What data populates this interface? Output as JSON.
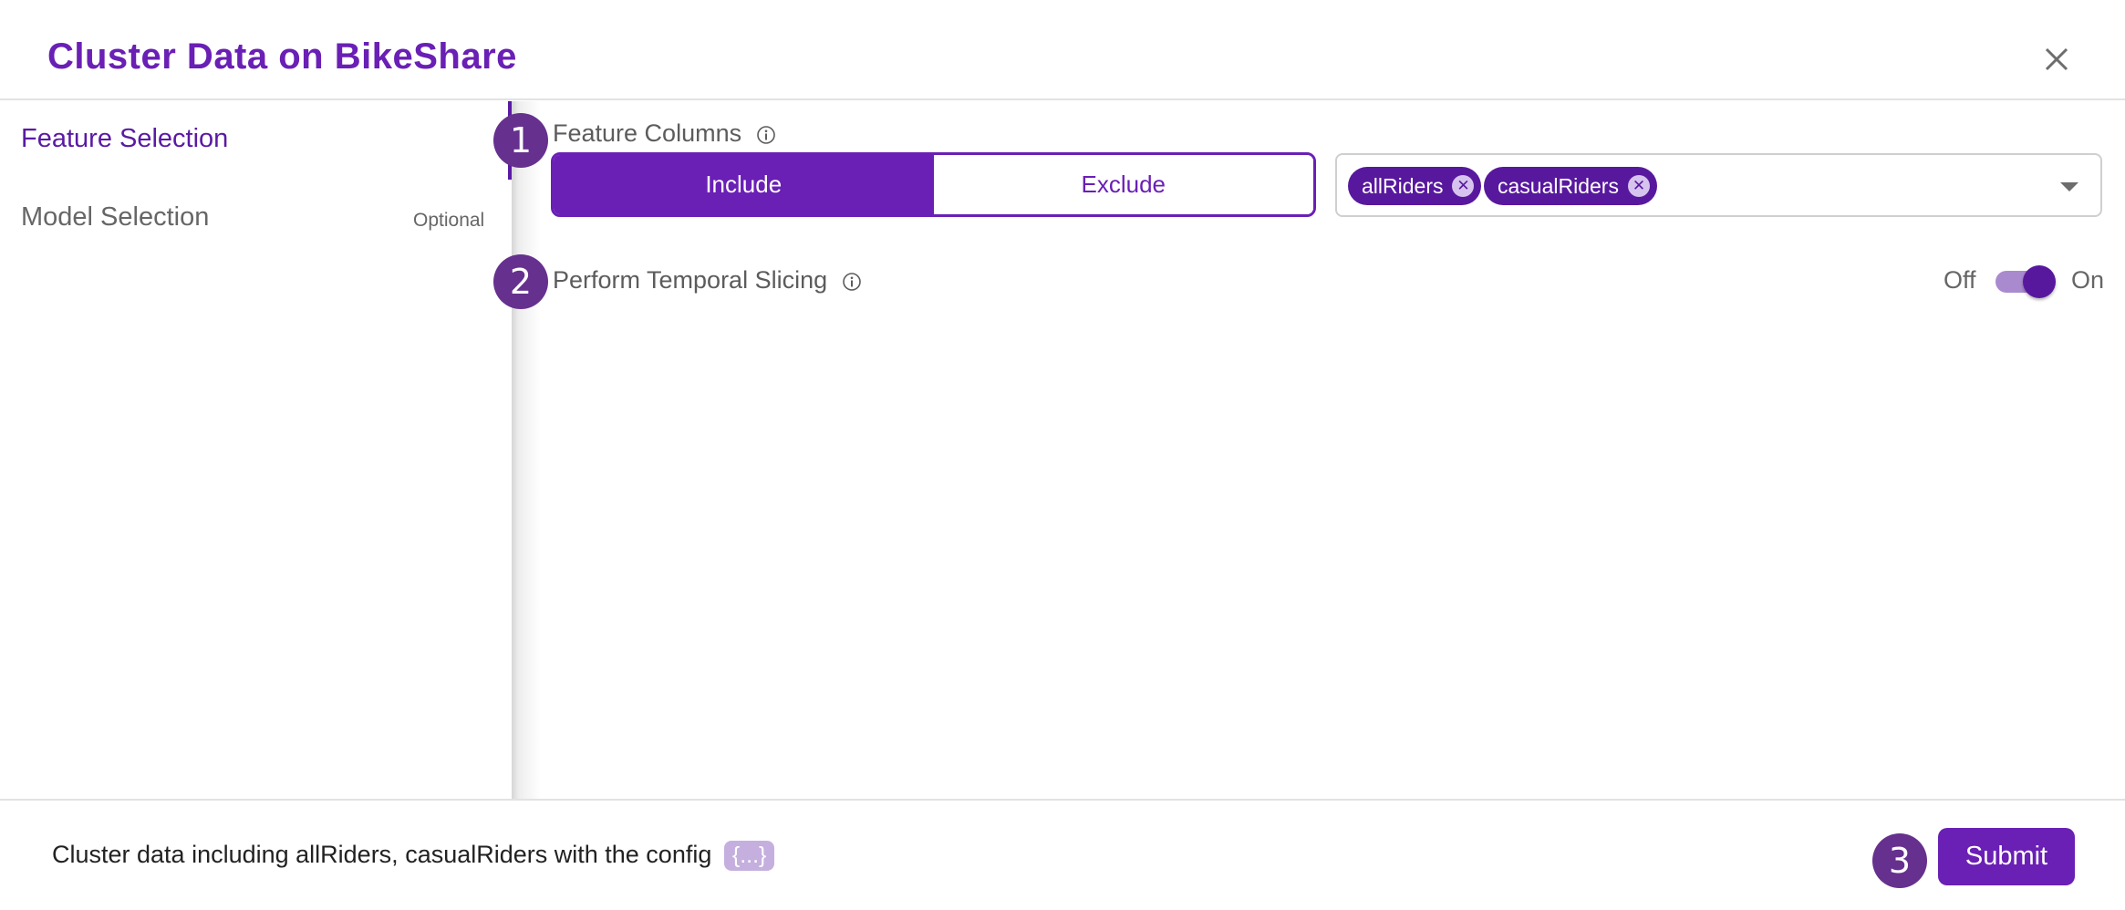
{
  "dialog": {
    "title": "Cluster Data on BikeShare",
    "close_icon": "close-icon"
  },
  "sidebar": {
    "items": [
      {
        "label": "Feature Selection",
        "active": true,
        "tag": ""
      },
      {
        "label": "Model Selection",
        "active": false,
        "tag": "Optional"
      }
    ]
  },
  "steps": {
    "one": "1",
    "two": "2",
    "three": "3"
  },
  "feature_columns": {
    "label": "Feature Columns",
    "info_icon": "info-icon",
    "mode_options": [
      "Include",
      "Exclude"
    ],
    "selected_mode": "Include",
    "selected_columns": [
      "allRiders",
      "casualRiders"
    ],
    "remove_glyph": "✕"
  },
  "temporal_slicing": {
    "label": "Perform Temporal Slicing",
    "info_icon": "info-icon",
    "off_label": "Off",
    "on_label": "On",
    "enabled": true
  },
  "footer": {
    "summary": "Cluster data including allRiders, casualRiders with the config",
    "config_chip": "{...}",
    "submit_label": "Submit"
  },
  "colors": {
    "accent": "#6a1fb5",
    "chip": "#58189e",
    "badge": "#66308e",
    "toggle_track": "#a98acf",
    "config_chip": "#c5afdf"
  }
}
